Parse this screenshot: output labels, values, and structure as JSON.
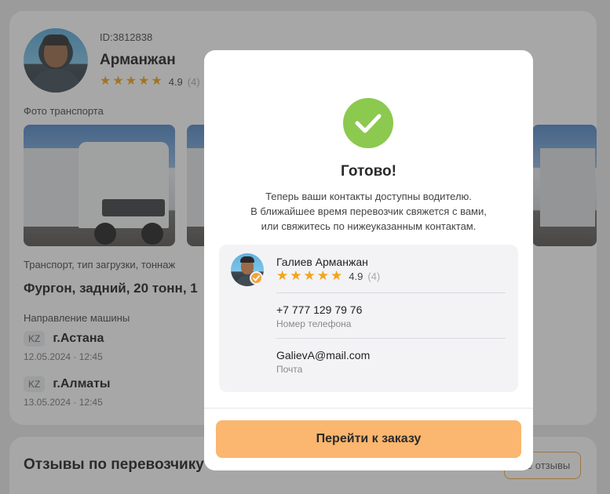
{
  "profile": {
    "id_label": "ID:3812838",
    "name": "Арманжан",
    "rating": "4.9",
    "rating_count": "(4)"
  },
  "photos": {
    "title": "Фото транспорта"
  },
  "transport": {
    "label": "Транспорт, тип загрузки, тоннаж",
    "value": "Фургон, задний, 20 тонн, 1"
  },
  "direction": {
    "label": "Направление машины",
    "routes": [
      {
        "country": "KZ",
        "city": "г.Астана",
        "date": "12.05.2024 · 12:45"
      },
      {
        "country": "KZ",
        "city": "г.Алматы",
        "date": "13.05.2024 · 12:45"
      }
    ]
  },
  "reviews": {
    "title": "Отзывы по перевозчику",
    "button": "Все отзывы"
  },
  "modal": {
    "title": "Готово!",
    "text_lines": [
      "Теперь ваши контакты доступны водителю.",
      "В ближайшее время перевозчик свяжется с вами,",
      "или свяжитесь по нижеуказанным контактам."
    ],
    "driver_name": "Галиев Арманжан",
    "rating": "4.9",
    "rating_count": "(4)",
    "phone": "+7 777 129 79 76",
    "phone_label": "Номер телефона",
    "email": "GalievA@mail.com",
    "email_label": "Почта",
    "button": "Перейти к заказу"
  },
  "colors": {
    "accent": "#fbb66f",
    "success": "#8cc94f",
    "star": "#f2a516"
  }
}
